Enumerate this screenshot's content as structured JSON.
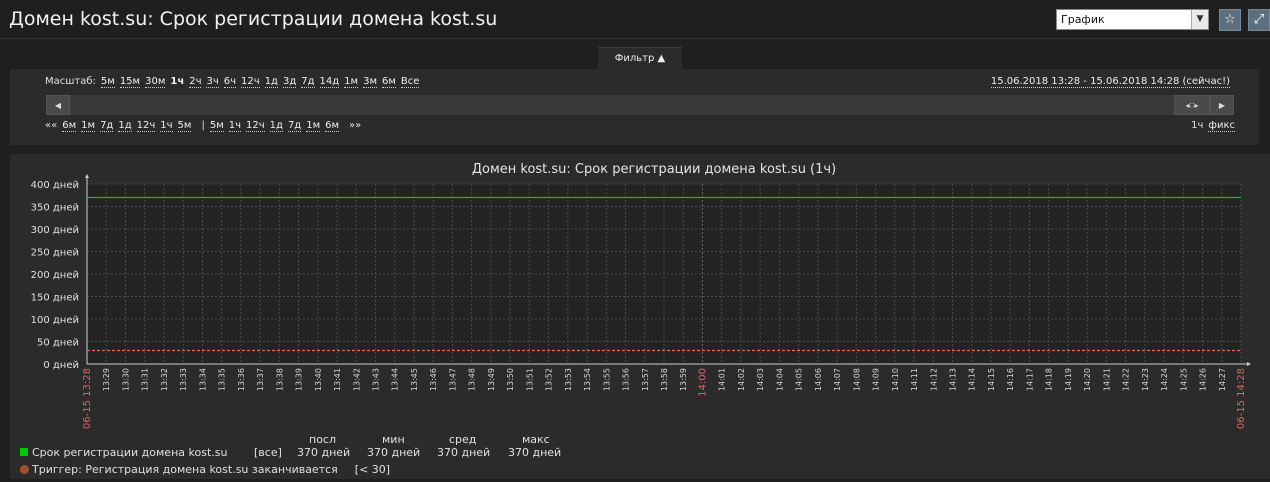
{
  "header": {
    "title": "Домен kost.su: Срок регистрации домена kost.su",
    "view_select": "График",
    "favorite_icon": "star-icon",
    "fullscreen_icon": "fullscreen-icon"
  },
  "filter": {
    "tab_label": "Фильтр ▲",
    "zoom_label": "Масштаб:",
    "zoom_options": [
      "5м",
      "15м",
      "30м",
      "1ч",
      "2ч",
      "3ч",
      "6ч",
      "12ч",
      "1д",
      "3д",
      "7д",
      "14д",
      "1м",
      "3м",
      "6м",
      "Все"
    ],
    "zoom_selected": "1ч",
    "period": "15.06.2018 13:28 - 15.06.2018 14:28 (сейчас!)",
    "nav_left_back": "««",
    "nav_back": [
      "6м",
      "1м",
      "7д",
      "1д",
      "12ч",
      "1ч",
      "5м"
    ],
    "nav_sep": "|",
    "nav_forward": [
      "5м",
      "1ч",
      "12ч",
      "1д",
      "7д",
      "1м",
      "6м"
    ],
    "nav_right_forward": "»»",
    "duration": "1ч",
    "fixed": "фикс"
  },
  "chart_data": {
    "type": "line",
    "title": "Домен kost.su: Срок регистрации домена kost.su (1ч)",
    "ylim": [
      0,
      400
    ],
    "yticks": [
      "0 дней",
      "50 дней",
      "100 дней",
      "150 дней",
      "200 дней",
      "250 дней",
      "300 дней",
      "350 дней",
      "400 дней"
    ],
    "xticks": [
      "13:29",
      "13:30",
      "13:31",
      "13:32",
      "13:33",
      "13:34",
      "13:35",
      "13:36",
      "13:37",
      "13:38",
      "13:39",
      "13:40",
      "13:41",
      "13:42",
      "13:43",
      "13:44",
      "13:45",
      "13:46",
      "13:47",
      "13:48",
      "13:49",
      "13:50",
      "13:51",
      "13:52",
      "13:53",
      "13:54",
      "13:55",
      "13:56",
      "13:57",
      "13:58",
      "13:59",
      "14:00",
      "14:01",
      "14:02",
      "14:03",
      "14:04",
      "14:05",
      "14:06",
      "14:07",
      "14:08",
      "14:09",
      "14:10",
      "14:11",
      "14:12",
      "14:13",
      "14:14",
      "14:15",
      "14:16",
      "14:17",
      "14:18",
      "14:19",
      "14:20",
      "14:21",
      "14:22",
      "14:23",
      "14:24",
      "14:25",
      "14:26",
      "14:27"
    ],
    "x_start_label": "06-15 13:28",
    "x_end_label": "06-15 14:28",
    "highlight_tick": "14:00",
    "grid": true,
    "series": [
      {
        "name": "Срок регистрации домена kost.su",
        "color": "#00c800",
        "x": [
          "13:28",
          "14:28"
        ],
        "values": [
          370,
          370
        ]
      }
    ],
    "trigger": {
      "value": 30,
      "color": "#e07050"
    }
  },
  "legend": {
    "headers": {
      "last": "посл",
      "min": "мин",
      "avg": "сред",
      "max": "макс"
    },
    "series_name": "Срок регистрации домена kost.su",
    "series_scope": "[все]",
    "series_color": "#00c800",
    "last": "370 дней",
    "min": "370 дней",
    "avg": "370 дней",
    "max": "370 дней",
    "trigger_name": "Триггер: Регистрация домена kost.su заканчивается",
    "trigger_cond": "[< 30]",
    "trigger_color": "#a0522d"
  }
}
